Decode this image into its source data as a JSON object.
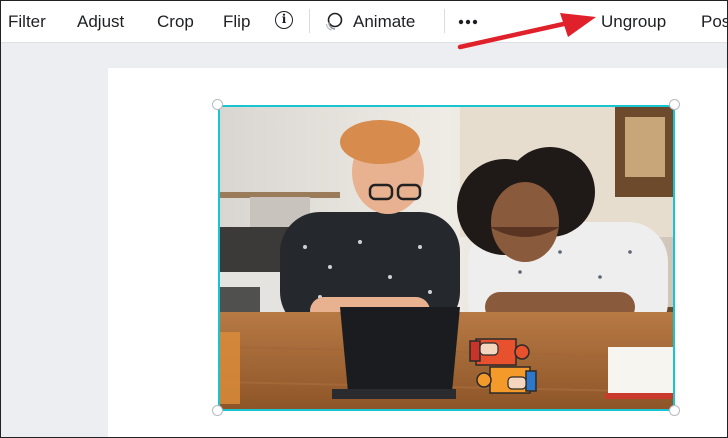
{
  "toolbar": {
    "filter_label": "Filter",
    "adjust_label": "Adjust",
    "crop_label": "Crop",
    "flip_label": "Flip",
    "info_icon": "info-icon",
    "animate_label": "Animate",
    "animate_icon": "animate-icon",
    "more_icon": "more-dots-icon",
    "ungroup_label": "Ungroup",
    "position_label": "Pos"
  },
  "canvas": {
    "photo_alt": "photo",
    "sticker_icon": "puzzle-handshake-sticker"
  },
  "annotation": {
    "arrow_color": "#e0202a"
  },
  "colors": {
    "selection": "#18c4d0",
    "canvas_bg": "#eceef1"
  }
}
